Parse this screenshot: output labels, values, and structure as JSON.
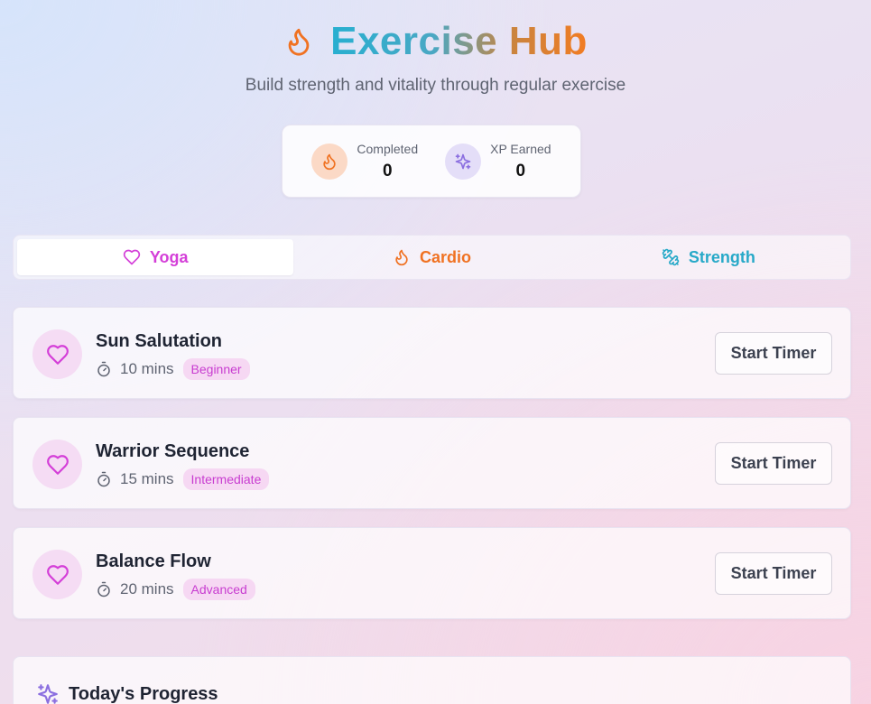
{
  "header": {
    "title": "Exercise Hub",
    "subtitle": "Build strength and vitality through regular exercise",
    "icon": "flame-icon"
  },
  "stats": [
    {
      "label": "Completed",
      "value": "0",
      "icon": "flame-icon"
    },
    {
      "label": "XP Earned",
      "value": "0",
      "icon": "sparkles-icon"
    }
  ],
  "tabs": [
    {
      "label": "Yoga",
      "icon": "heart-icon",
      "active": true
    },
    {
      "label": "Cardio",
      "icon": "flame-icon",
      "active": false
    },
    {
      "label": "Strength",
      "icon": "dumbbell-icon",
      "active": false
    }
  ],
  "exercises": [
    {
      "name": "Sun Salutation",
      "duration": "10 mins",
      "level": "Beginner",
      "action": "Start Timer"
    },
    {
      "name": "Warrior Sequence",
      "duration": "15 mins",
      "level": "Intermediate",
      "action": "Start Timer"
    },
    {
      "name": "Balance Flow",
      "duration": "20 mins",
      "level": "Advanced",
      "action": "Start Timer"
    }
  ],
  "progress": {
    "title": "Today's Progress"
  },
  "colors": {
    "yoga": "#d43fd8",
    "cardio": "#f07222",
    "strength": "#27a9c8",
    "xp": "#8b6fe0"
  }
}
